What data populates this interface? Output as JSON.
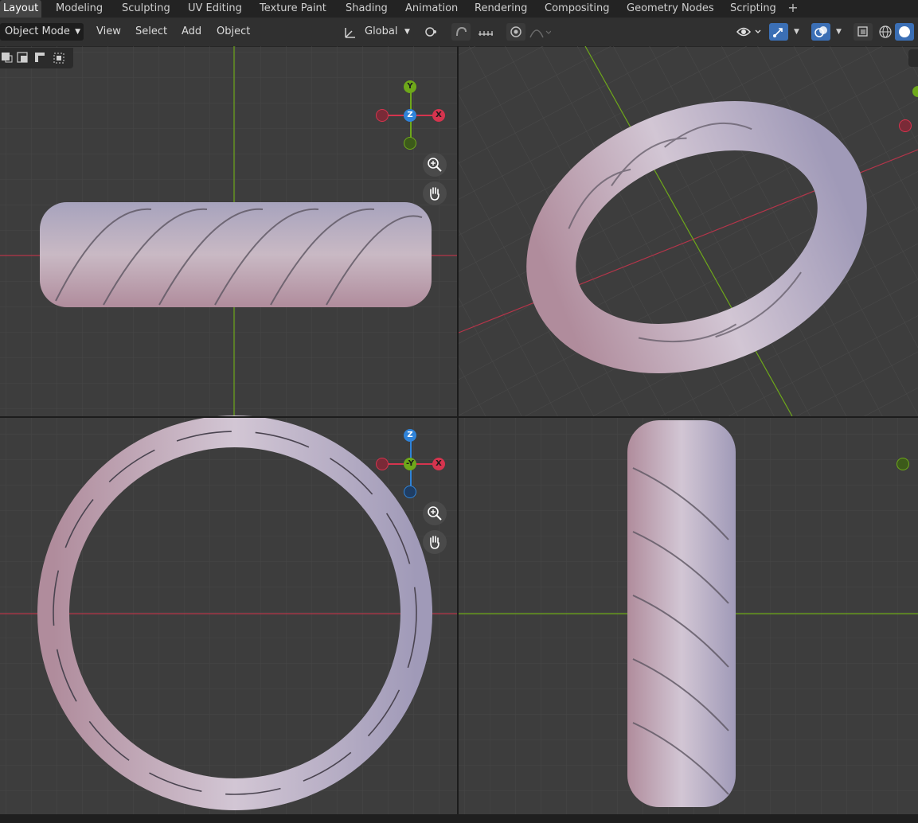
{
  "workspace_tabs": [
    {
      "label": "Layout",
      "active": true
    },
    {
      "label": "Modeling"
    },
    {
      "label": "Sculpting"
    },
    {
      "label": "UV Editing"
    },
    {
      "label": "Texture Paint"
    },
    {
      "label": "Shading"
    },
    {
      "label": "Animation"
    },
    {
      "label": "Rendering"
    },
    {
      "label": "Compositing"
    },
    {
      "label": "Geometry Nodes"
    },
    {
      "label": "Scripting"
    }
  ],
  "header": {
    "mode": "Object Mode",
    "menus": [
      "View",
      "Select",
      "Add",
      "Object"
    ],
    "orientation": "Global"
  },
  "gizmo_labels": {
    "top_view": {
      "up": "Y",
      "center": "Z",
      "right": "X"
    },
    "front_view": {
      "up": "Z",
      "center": "-Y",
      "right": "X"
    }
  },
  "colors": {
    "axis_x": "#d5344e",
    "axis_y": "#6ea81a",
    "axis_z": "#2f83d9",
    "accent": "#3b6fb5",
    "viewport_bg": "#3d3d3d",
    "grid_line": "#474747",
    "ring_shade": "#b7aab8"
  },
  "icons": [
    "transform-orientation-icon",
    "link-icon",
    "snap-icon",
    "snap-increment-icon",
    "proportional-edit-icon",
    "falloff-icon",
    "visibility-icon",
    "gizmo-icon",
    "overlay-icon",
    "xray-icon",
    "wireframe-shading-icon",
    "solid-shading-icon",
    "zoom-icon",
    "hand-icon",
    "add-workspace-icon"
  ]
}
